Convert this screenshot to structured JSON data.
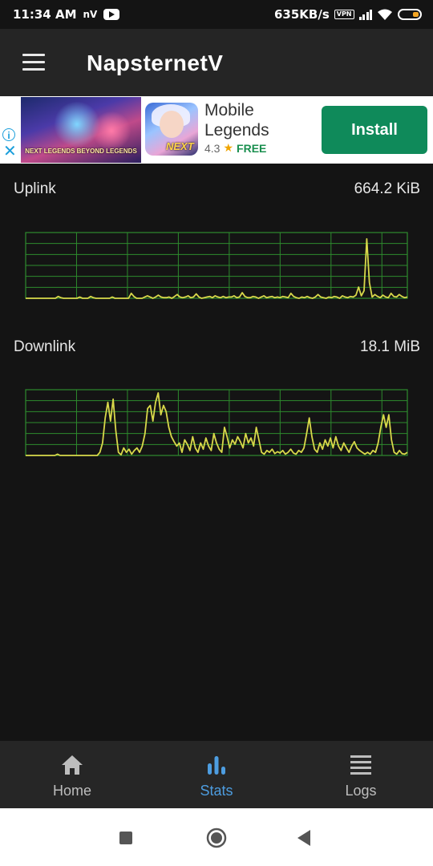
{
  "status_bar": {
    "time": "11:34 AM",
    "carrier_badge": "nV",
    "net_speed": "635KB/s",
    "vpn_badge": "VPN"
  },
  "app_bar": {
    "title": "NapsternetV"
  },
  "ad": {
    "banner_text": "NEXT LEGENDS BEYOND LEGENDS",
    "icon_text": "NEXT",
    "title": "Mobile Legends",
    "rating": "4.3",
    "star": "★",
    "price": "FREE",
    "install_label": "Install",
    "info_glyph": "i",
    "close_glyph": "✕"
  },
  "stats": {
    "uplink": {
      "label": "Uplink",
      "value": "664.2 KiB",
      "samples": [
        0,
        0,
        0,
        0,
        0,
        0,
        0,
        0,
        0,
        0,
        0,
        0,
        0.03,
        0.01,
        0,
        0,
        0,
        0,
        0,
        0,
        0.02,
        0,
        0,
        0,
        0.03,
        0.01,
        0,
        0,
        0,
        0,
        0,
        0,
        0.02,
        0,
        0,
        0,
        0,
        0,
        0,
        0.08,
        0.03,
        0,
        0,
        0,
        0.02,
        0.04,
        0.02,
        0,
        0.02,
        0.05,
        0.02,
        0.01,
        0.01,
        0.02,
        0,
        0.03,
        0.06,
        0.02,
        0.01,
        0.02,
        0.04,
        0.01,
        0.02,
        0.07,
        0.02,
        0,
        0.01,
        0.02,
        0.03,
        0.01,
        0.04,
        0.02,
        0.01,
        0.03,
        0.01,
        0.02,
        0.02,
        0.04,
        0.01,
        0.02,
        0.09,
        0.03,
        0.01,
        0.01,
        0.03,
        0.02,
        0,
        0.02,
        0.04,
        0.01,
        0.02,
        0.03,
        0.01,
        0.02,
        0.01,
        0.03,
        0.02,
        0.01,
        0.08,
        0.03,
        0.01,
        0,
        0.02,
        0.01,
        0.03,
        0.01,
        0,
        0.02,
        0.06,
        0.02,
        0.01,
        0,
        0.02,
        0.01,
        0.03,
        0.02,
        0,
        0.04,
        0.02,
        0.01,
        0.03,
        0.02,
        0.05,
        0.18,
        0.04,
        0.12,
        0.95,
        0.25,
        0.02,
        0.06,
        0.03,
        0.01,
        0.05,
        0.02,
        0.01,
        0.08,
        0.03,
        0.02,
        0.06,
        0.03,
        0.01,
        0.02
      ],
      "color": "#d8d84a"
    },
    "downlink": {
      "label": "Downlink",
      "value": "18.1 MiB",
      "samples": [
        0,
        0,
        0,
        0,
        0,
        0,
        0,
        0,
        0,
        0,
        0,
        0,
        0.02,
        0,
        0,
        0,
        0,
        0,
        0,
        0,
        0,
        0,
        0,
        0,
        0,
        0,
        0,
        0,
        0.05,
        0.2,
        0.6,
        0.85,
        0.55,
        0.9,
        0.4,
        0.05,
        0.01,
        0.12,
        0.05,
        0.1,
        0.02,
        0.08,
        0.12,
        0.05,
        0.15,
        0.35,
        0.75,
        0.8,
        0.55,
        0.85,
        1.0,
        0.65,
        0.8,
        0.7,
        0.45,
        0.3,
        0.22,
        0.15,
        0.2,
        0.05,
        0.25,
        0.18,
        0.08,
        0.3,
        0.12,
        0.05,
        0.2,
        0.1,
        0.28,
        0.15,
        0.08,
        0.35,
        0.2,
        0.1,
        0.05,
        0.45,
        0.3,
        0.12,
        0.25,
        0.18,
        0.3,
        0.22,
        0.12,
        0.35,
        0.2,
        0.28,
        0.15,
        0.45,
        0.25,
        0.05,
        0.02,
        0.08,
        0.05,
        0.1,
        0.03,
        0.06,
        0.04,
        0.08,
        0.02,
        0.05,
        0.1,
        0.04,
        0.02,
        0.08,
        0.05,
        0.12,
        0.35,
        0.6,
        0.3,
        0.1,
        0.05,
        0.2,
        0.1,
        0.25,
        0.15,
        0.28,
        0.12,
        0.3,
        0.15,
        0.08,
        0.2,
        0.12,
        0.05,
        0.15,
        0.22,
        0.12,
        0.08,
        0.05,
        0.02,
        0.05,
        0.02,
        0.08,
        0.05,
        0.2,
        0.45,
        0.65,
        0.45,
        0.65,
        0.25,
        0.05,
        0.02,
        0.08,
        0.03,
        0.02,
        0.05
      ],
      "color": "#d8d84a"
    },
    "grid_color": "#2e8b2e"
  },
  "bottom_nav": {
    "items": [
      {
        "label": "Home",
        "icon": "home-icon"
      },
      {
        "label": "Stats",
        "icon": "bar-chart-icon"
      },
      {
        "label": "Logs",
        "icon": "list-icon"
      }
    ],
    "active_color": "#4d9de0"
  },
  "system_nav": {
    "buttons": [
      "recents",
      "home",
      "back"
    ]
  }
}
